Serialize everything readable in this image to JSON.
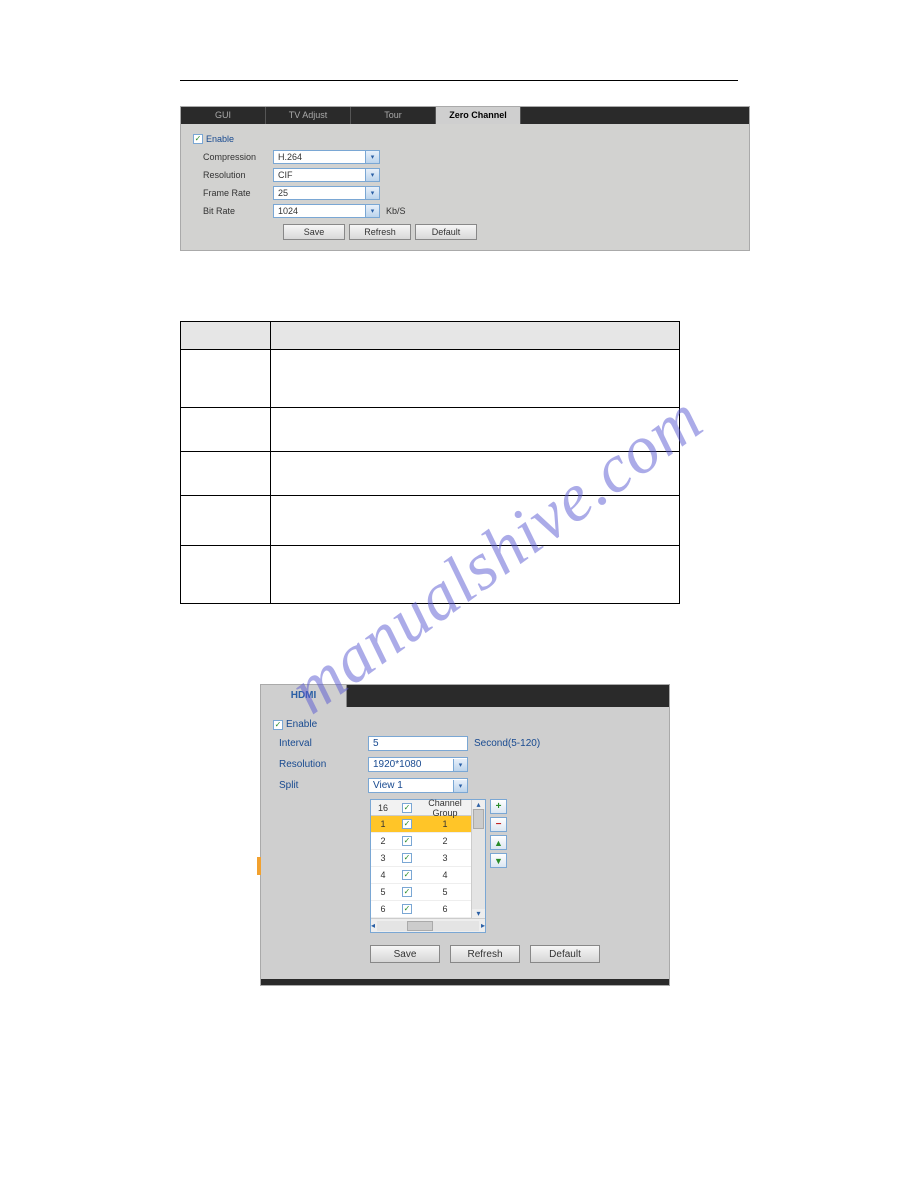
{
  "watermark": "manualshive.com",
  "panel1": {
    "tabs": {
      "t1": "GUI",
      "t2": "TV Adjust",
      "t3": "Tour",
      "t4": "Zero Channel"
    },
    "enable_label": "Enable",
    "enable_checked": true,
    "rows": {
      "compression": {
        "label": "Compression",
        "value": "H.264"
      },
      "resolution": {
        "label": "Resolution",
        "value": "CIF"
      },
      "framerate": {
        "label": "Frame Rate",
        "value": "25"
      },
      "bitrate": {
        "label": "Bit Rate",
        "value": "1024",
        "unit": "Kb/S"
      }
    },
    "buttons": {
      "save": "Save",
      "refresh": "Refresh",
      "default": "Default"
    }
  },
  "panel2": {
    "tab": "HDMI",
    "enable_label": "Enable",
    "enable_checked": true,
    "interval": {
      "label": "Interval",
      "value": "5",
      "suffix": "Second(5-120)"
    },
    "resolution": {
      "label": "Resolution",
      "value": "1920*1080"
    },
    "split": {
      "label": "Split",
      "value": "View 1"
    },
    "grid": {
      "header_count": "16",
      "header_label": "Channel Group",
      "rows": [
        {
          "idx": "1",
          "checked": true,
          "group": "1",
          "selected": true
        },
        {
          "idx": "2",
          "checked": true,
          "group": "2",
          "selected": false
        },
        {
          "idx": "3",
          "checked": true,
          "group": "3",
          "selected": false
        },
        {
          "idx": "4",
          "checked": true,
          "group": "4",
          "selected": false
        },
        {
          "idx": "5",
          "checked": true,
          "group": "5",
          "selected": false
        },
        {
          "idx": "6",
          "checked": true,
          "group": "6",
          "selected": false
        }
      ]
    },
    "sidebtn": {
      "add": "+",
      "remove": "−",
      "up": "▲",
      "down": "▼"
    },
    "buttons": {
      "save": "Save",
      "refresh": "Refresh",
      "default": "Default"
    }
  }
}
